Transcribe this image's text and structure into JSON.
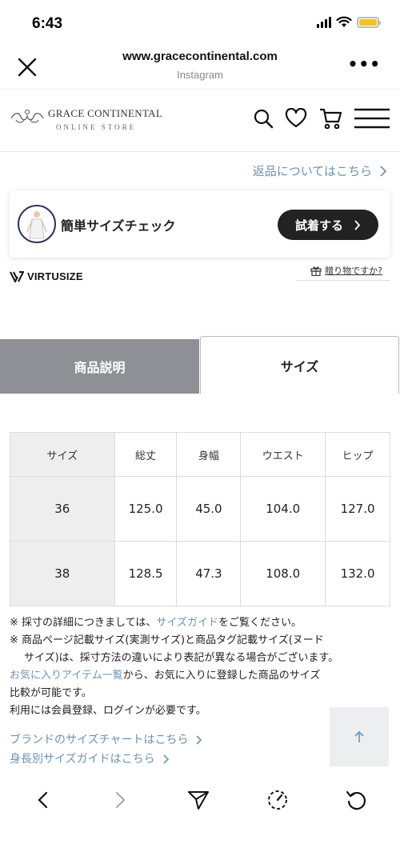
{
  "status_bar": {
    "time": "6:43"
  },
  "browser": {
    "url": "www.gracecontinental.com",
    "subtitle": "Instagram",
    "more": "•••"
  },
  "store": {
    "name": "GRACE CONTINENTAL",
    "tagline": "ONLINE STORE"
  },
  "return_link": "返品についてはこちら",
  "size_check": {
    "label": "簡単サイズチェック",
    "button": "試着する"
  },
  "virtusize": "VIRTUSIZE",
  "gift_link": "贈り物ですか?",
  "tabs": [
    {
      "label": "商品説明",
      "active": false
    },
    {
      "label": "サイズ",
      "active": true
    }
  ],
  "size_table": {
    "headers": [
      "サイズ",
      "総丈",
      "身幅",
      "ウエスト",
      "ヒップ"
    ],
    "rows": [
      [
        "36",
        "125.0",
        "45.0",
        "104.0",
        "127.0"
      ],
      [
        "38",
        "128.5",
        "47.3",
        "108.0",
        "132.0"
      ]
    ]
  },
  "notes": {
    "n1_prefix": "※ 採寸の詳細につきましては、",
    "n1_link": "サイズガイド",
    "n1_suffix": "をご覧ください。",
    "n2_line1": "※ 商品ページ記載サイズ(実測サイズ)と商品タグ記載サイズ(ヌード",
    "n2_line2": "サイズ)は、採寸方法の違いにより表記が異なる場合がございます。",
    "fav_link": "お気に入りアイテム一覧",
    "fav_text1": "から、お気に入りに登録した商品のサイズ",
    "fav_text2": "比較が可能です。",
    "member": "利用には会員登録、ログインが必要です。"
  },
  "links": {
    "brand_chart": "ブランドのサイズチャートはこちら",
    "height_guide": "身長別サイズガイドはこちら"
  },
  "colors": {
    "link": "#6c93b5",
    "tab_inactive": "#8e9096",
    "button": "#222222",
    "battery": "#f2c417"
  }
}
